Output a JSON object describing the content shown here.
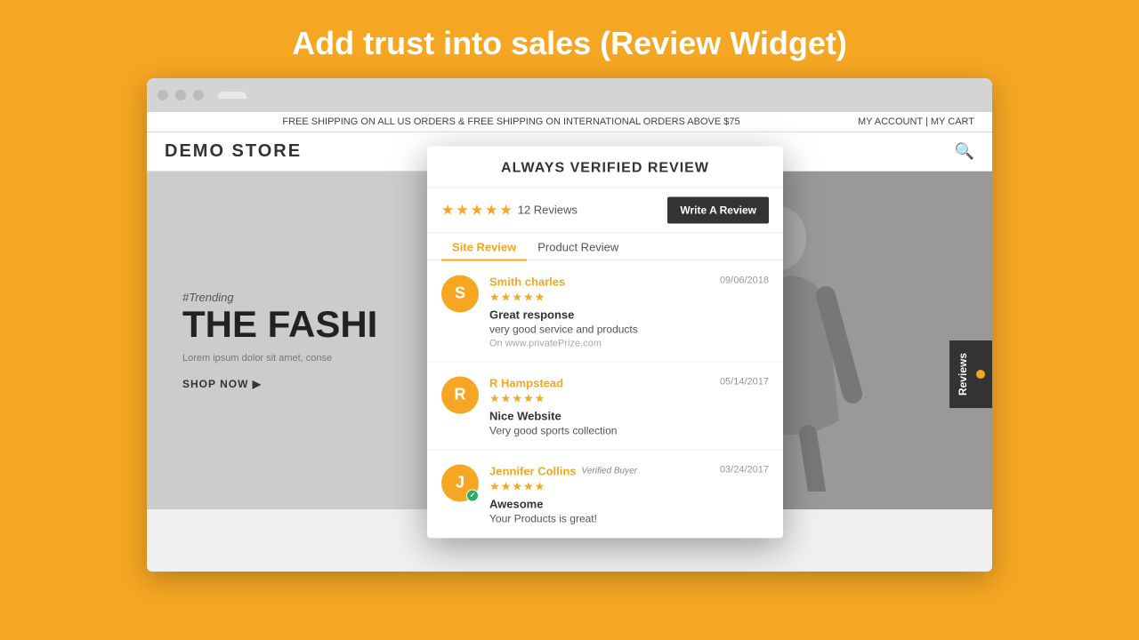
{
  "page": {
    "title": "Add trust into sales (Review Widget)"
  },
  "browser": {
    "dots": [
      "dot1",
      "dot2",
      "dot3"
    ]
  },
  "store": {
    "promo_text": "FREE SHIPPING ON ALL US ORDERS & FREE SHIPPING ON INTERNATIONAL ORDERS ABOVE $75",
    "account_links": "MY ACCOUNT  |  MY CART",
    "logo": "DEMO STORE",
    "hero": {
      "trending": "#Trending",
      "title": "THE FASHI",
      "subtitle": "Lorem ipsum dolor sit amet, conse",
      "cta": "SHOP NOW ▶"
    }
  },
  "reviews_tab": {
    "label": "Reviews"
  },
  "modal": {
    "title": "ALWAYS VERIFIED REVIEW",
    "rating_count": "12 Reviews",
    "write_review_label": "Write A Review",
    "tabs": [
      {
        "label": "Site Review",
        "active": true
      },
      {
        "label": "Product Review",
        "active": false
      }
    ],
    "reviews": [
      {
        "avatar_letter": "S",
        "name": "Smith charles",
        "verified": false,
        "date": "09/06/2018",
        "stars": 5,
        "headline": "Great response",
        "text": "very good service and products",
        "site": "On www.privatePrize.com"
      },
      {
        "avatar_letter": "R",
        "name": "R Hampstead",
        "verified": false,
        "date": "05/14/2017",
        "stars": 5,
        "headline": "Nice Website",
        "text": "Very good sports collection",
        "site": ""
      },
      {
        "avatar_letter": "J",
        "name": "Jennifer Collins",
        "verified": true,
        "verified_label": "Verified Buyer",
        "date": "03/24/2017",
        "stars": 5,
        "headline": "Awesome",
        "text": "Your Products is great!",
        "site": ""
      }
    ]
  }
}
